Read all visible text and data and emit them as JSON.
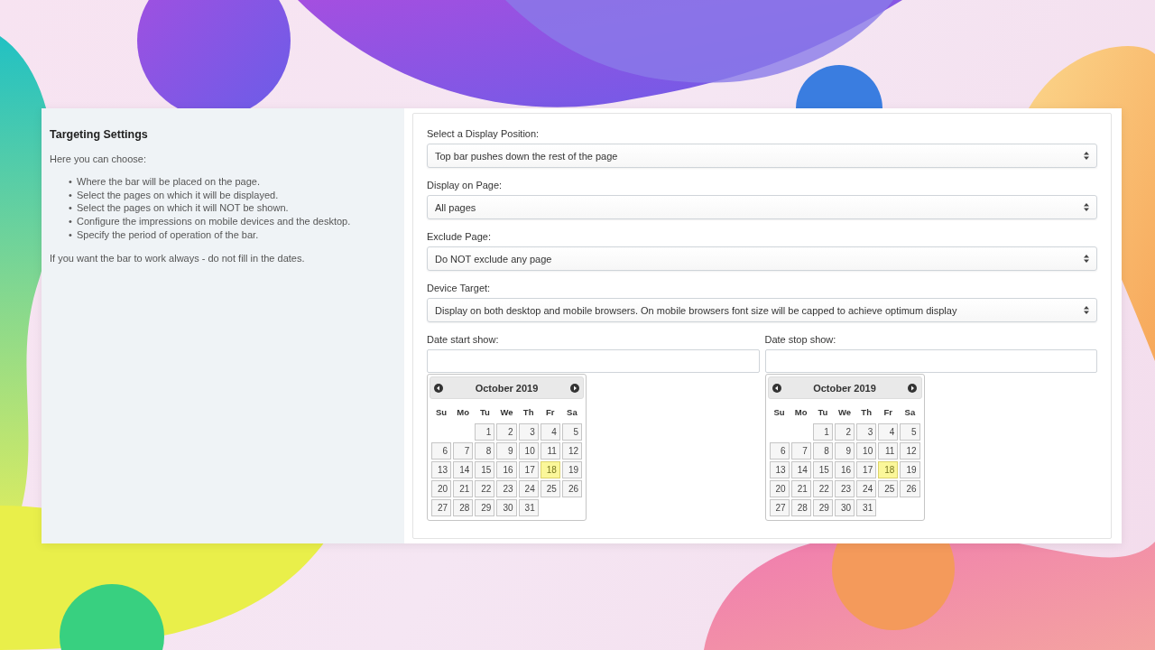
{
  "info": {
    "title": "Targeting Settings",
    "intro": "Here you can choose:",
    "bullets": [
      {
        "marker": "•",
        "text": "Where the bar will be placed on the page."
      },
      {
        "marker": "•",
        "text": "Select the pages on which it will be displayed."
      },
      {
        "marker": "•",
        "text": "Select the pages on which it will NOT be shown."
      },
      {
        "marker": "•",
        "text": "Configure the impressions on mobile devices and the desktop."
      },
      {
        "marker": "•",
        "text": "Specify the period of operation of the bar."
      }
    ],
    "note": "If you want the bar to work always - do not fill in the dates."
  },
  "selects": [
    {
      "label": "Select a Display Position:",
      "value": "Top bar pushes down the rest of the page"
    },
    {
      "label": "Display on Page:",
      "value": "All pages"
    },
    {
      "label": "Exclude Page:",
      "value": "Do NOT exclude any page"
    },
    {
      "label": "Device Target:",
      "value": "Display on both desktop and mobile browsers. On mobile browsers font size will be capped to achieve optimum display"
    }
  ],
  "date_fields": [
    {
      "label": "Date start show:",
      "calendar": {
        "month": "October 2019",
        "weekdays": [
          "Su",
          "Mo",
          "Tu",
          "We",
          "Th",
          "Fr",
          "Sa"
        ],
        "weeks": [
          [
            {
              "day": "1",
              "selected": false
            },
            {
              "day": "2",
              "selected": false
            },
            {
              "day": "3",
              "selected": false
            },
            {
              "day": "4",
              "selected": false
            },
            {
              "day": "5",
              "selected": false
            }
          ],
          [
            {
              "day": "6",
              "selected": false
            },
            {
              "day": "7",
              "selected": false
            },
            {
              "day": "8",
              "selected": false
            },
            {
              "day": "9",
              "selected": false
            },
            {
              "day": "10",
              "selected": false
            },
            {
              "day": "11",
              "selected": false
            },
            {
              "day": "12",
              "selected": false
            }
          ],
          [
            {
              "day": "13",
              "selected": false
            },
            {
              "day": "14",
              "selected": false
            },
            {
              "day": "15",
              "selected": false
            },
            {
              "day": "16",
              "selected": false
            },
            {
              "day": "17",
              "selected": false
            },
            {
              "day": "18",
              "selected": true
            },
            {
              "day": "19",
              "selected": false
            }
          ],
          [
            {
              "day": "20",
              "selected": false
            },
            {
              "day": "21",
              "selected": false
            },
            {
              "day": "22",
              "selected": false
            },
            {
              "day": "23",
              "selected": false
            },
            {
              "day": "24",
              "selected": false
            },
            {
              "day": "25",
              "selected": false
            },
            {
              "day": "26",
              "selected": false
            }
          ],
          [
            {
              "day": "27",
              "selected": false
            },
            {
              "day": "28",
              "selected": false
            },
            {
              "day": "29",
              "selected": false
            },
            {
              "day": "30",
              "selected": false
            },
            {
              "day": "31",
              "selected": false
            }
          ]
        ]
      }
    },
    {
      "label": "Date stop show:",
      "calendar": {
        "month": "October 2019",
        "weekdays": [
          "Su",
          "Mo",
          "Tu",
          "We",
          "Th",
          "Fr",
          "Sa"
        ],
        "weeks": [
          [
            {
              "day": "1",
              "selected": false
            },
            {
              "day": "2",
              "selected": false
            },
            {
              "day": "3",
              "selected": false
            },
            {
              "day": "4",
              "selected": false
            },
            {
              "day": "5",
              "selected": false
            }
          ],
          [
            {
              "day": "6",
              "selected": false
            },
            {
              "day": "7",
              "selected": false
            },
            {
              "day": "8",
              "selected": false
            },
            {
              "day": "9",
              "selected": false
            },
            {
              "day": "10",
              "selected": false
            },
            {
              "day": "11",
              "selected": false
            },
            {
              "day": "12",
              "selected": false
            }
          ],
          [
            {
              "day": "13",
              "selected": false
            },
            {
              "day": "14",
              "selected": false
            },
            {
              "day": "15",
              "selected": false
            },
            {
              "day": "16",
              "selected": false
            },
            {
              "day": "17",
              "selected": false
            },
            {
              "day": "18",
              "selected": true
            },
            {
              "day": "19",
              "selected": false
            }
          ],
          [
            {
              "day": "20",
              "selected": false
            },
            {
              "day": "21",
              "selected": false
            },
            {
              "day": "22",
              "selected": false
            },
            {
              "day": "23",
              "selected": false
            },
            {
              "day": "24",
              "selected": false
            },
            {
              "day": "25",
              "selected": false
            },
            {
              "day": "26",
              "selected": false
            }
          ],
          [
            {
              "day": "27",
              "selected": false
            },
            {
              "day": "28",
              "selected": false
            },
            {
              "day": "29",
              "selected": false
            },
            {
              "day": "30",
              "selected": false
            },
            {
              "day": "31",
              "selected": false
            }
          ]
        ]
      }
    }
  ]
}
